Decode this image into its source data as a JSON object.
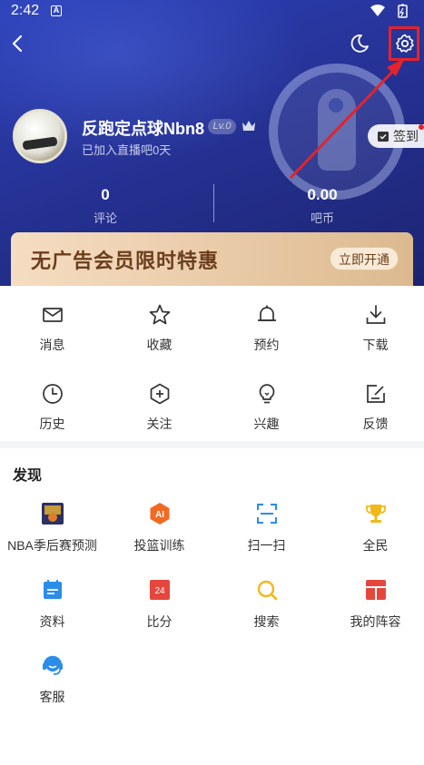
{
  "status_bar": {
    "time": "2:42",
    "notification_letter": "A"
  },
  "header": {
    "username": "反跑定点球Nbn8",
    "level": "Lv.0",
    "join_text": "已加入直播吧0天",
    "checkin_label": "签到",
    "stats": [
      {
        "value": "0",
        "label": "评论"
      },
      {
        "value": "0.00",
        "label": "吧币"
      }
    ],
    "background_color": "#27349a"
  },
  "vip_banner": {
    "text": "无广告会员限时特惠",
    "button_label": "立即开通"
  },
  "quick_menu": [
    {
      "label": "消息",
      "icon": "mail-icon"
    },
    {
      "label": "收藏",
      "icon": "star-icon"
    },
    {
      "label": "预约",
      "icon": "bell-icon"
    },
    {
      "label": "下载",
      "icon": "download-icon"
    },
    {
      "label": "历史",
      "icon": "clock-icon"
    },
    {
      "label": "关注",
      "icon": "plus-hexagon-icon"
    },
    {
      "label": "兴趣",
      "icon": "lightbulb-icon"
    },
    {
      "label": "反馈",
      "icon": "edit-icon"
    }
  ],
  "discover": {
    "title": "发现",
    "items": [
      {
        "label": "NBA季后赛预测",
        "icon": "nba-playoff-icon"
      },
      {
        "label": "投篮训练",
        "icon": "ai-shooting-icon",
        "icon_text": "AI"
      },
      {
        "label": "扫一扫",
        "icon": "scan-icon"
      },
      {
        "label": "全民",
        "icon": "trophy-icon"
      },
      {
        "label": "资料",
        "icon": "calendar-icon"
      },
      {
        "label": "比分",
        "icon": "score-icon",
        "icon_text": "24"
      },
      {
        "label": "搜索",
        "icon": "search-icon"
      },
      {
        "label": "我的阵容",
        "icon": "lineup-icon"
      },
      {
        "label": "客服",
        "icon": "customer-service-icon"
      }
    ]
  },
  "colors": {
    "accent_red": "#e3232b",
    "vip_brown": "#6b3e1c"
  }
}
